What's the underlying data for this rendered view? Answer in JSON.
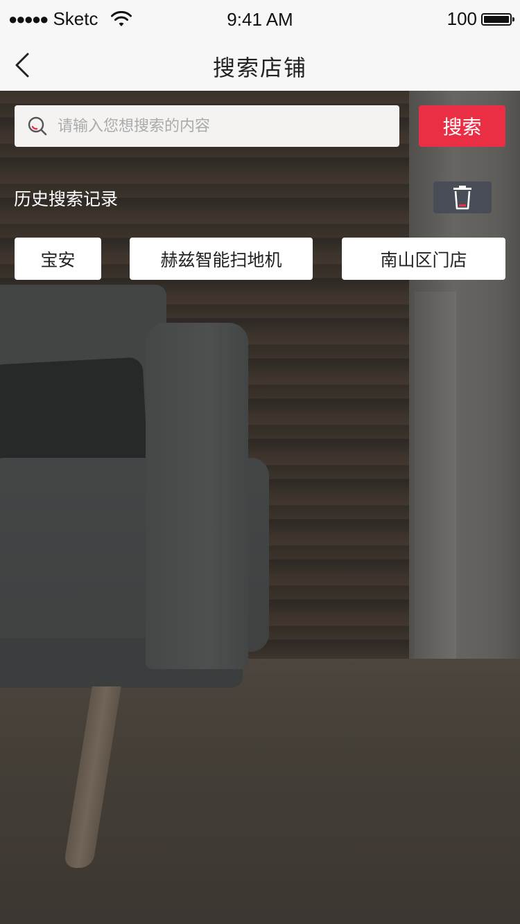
{
  "status_bar": {
    "signal_dots": "●●●●●",
    "carrier": "Sketc",
    "time": "9:41 AM",
    "battery": "100"
  },
  "nav": {
    "title": "搜索店铺",
    "back_icon": "chevron-left-icon"
  },
  "search": {
    "placeholder": "请输入您想搜索的内容",
    "value": "",
    "icon": "search-icon",
    "button_label": "搜索",
    "button_color": "#ea2f45"
  },
  "history": {
    "title": "历史搜索记录",
    "clear_icon": "trash-icon",
    "tags": [
      "宝安",
      "赫兹智能扫地机",
      "南山区门店"
    ]
  }
}
